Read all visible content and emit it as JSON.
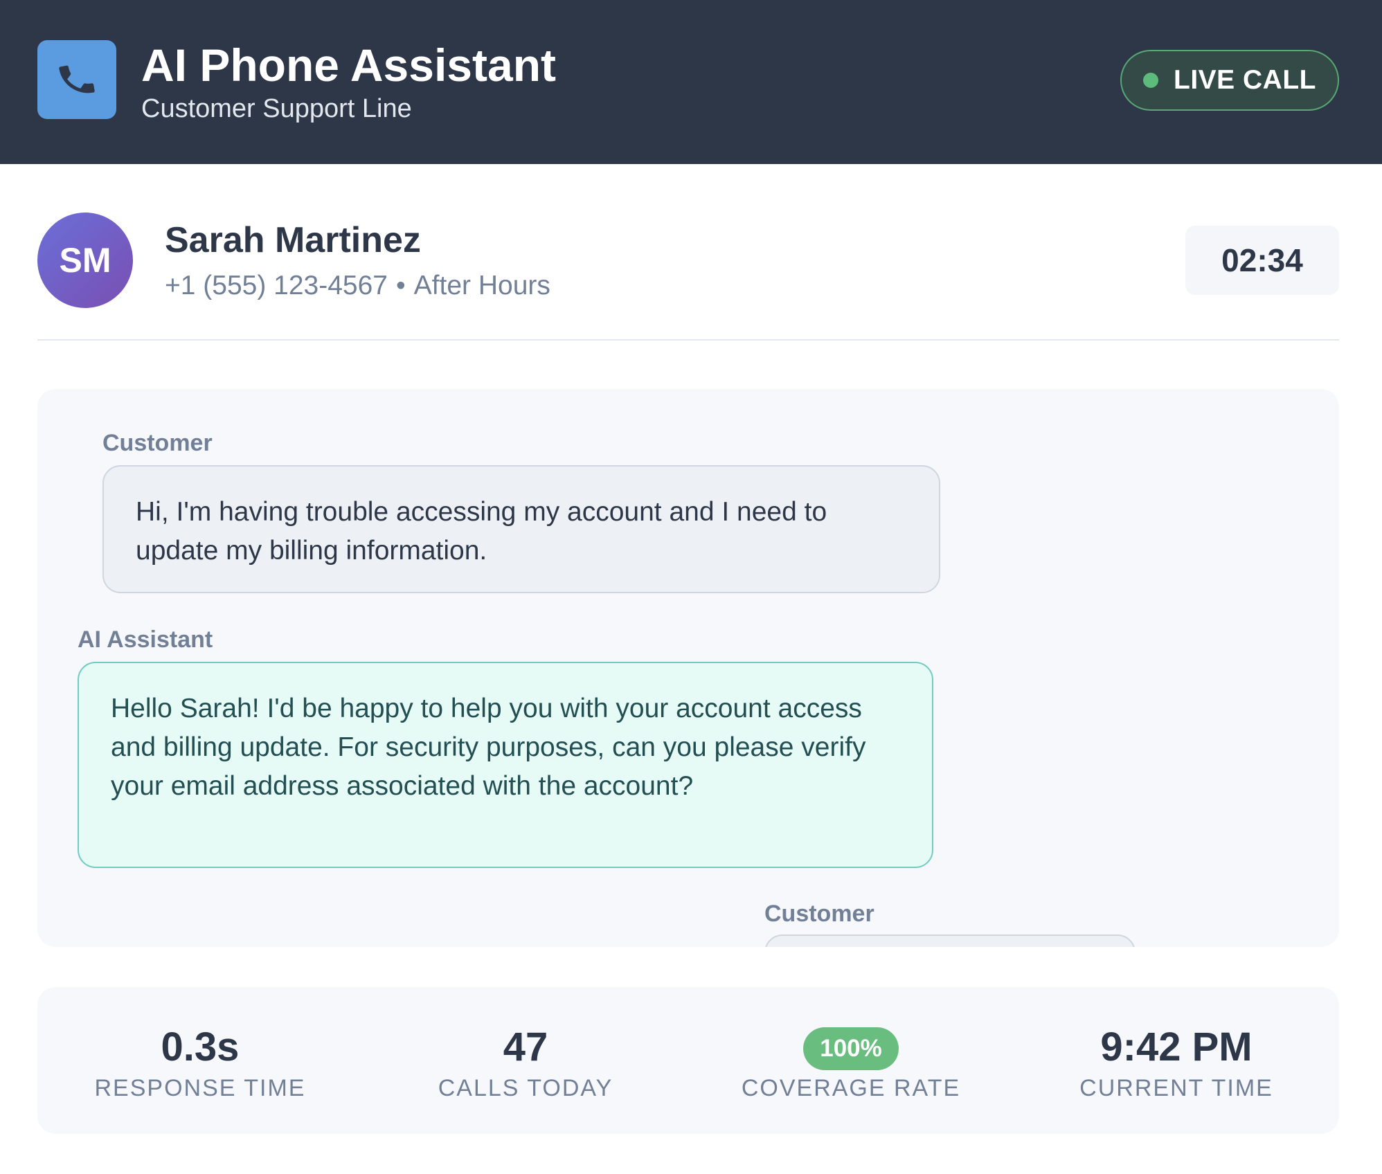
{
  "header": {
    "title": "AI Phone Assistant",
    "subtitle": "Customer Support Line",
    "app_icon": "phone-icon",
    "status_label": "LIVE CALL",
    "status_color": "#5dbb7c"
  },
  "caller": {
    "initials": "SM",
    "name": "Sarah Martinez",
    "phone": "+1 (555) 123-4567",
    "separator": "•",
    "context": "After Hours",
    "duration": "02:34"
  },
  "conversation": {
    "messages": [
      {
        "speaker": "Customer",
        "text": "Hi, I'm having trouble accessing my account and I need to update my billing information."
      },
      {
        "speaker": "AI Assistant",
        "text": "Hello Sarah! I'd be happy to help you with your account access and billing update. For security purposes, can you please verify your email address associated with the account?"
      },
      {
        "speaker": "Customer",
        "text": ""
      }
    ]
  },
  "stats": [
    {
      "value": "0.3s",
      "label": "RESPONSE TIME"
    },
    {
      "value": "47",
      "label": "CALLS TODAY"
    },
    {
      "value": "100%",
      "label": "COVERAGE RATE"
    },
    {
      "value": "9:42 PM",
      "label": "CURRENT TIME"
    }
  ]
}
